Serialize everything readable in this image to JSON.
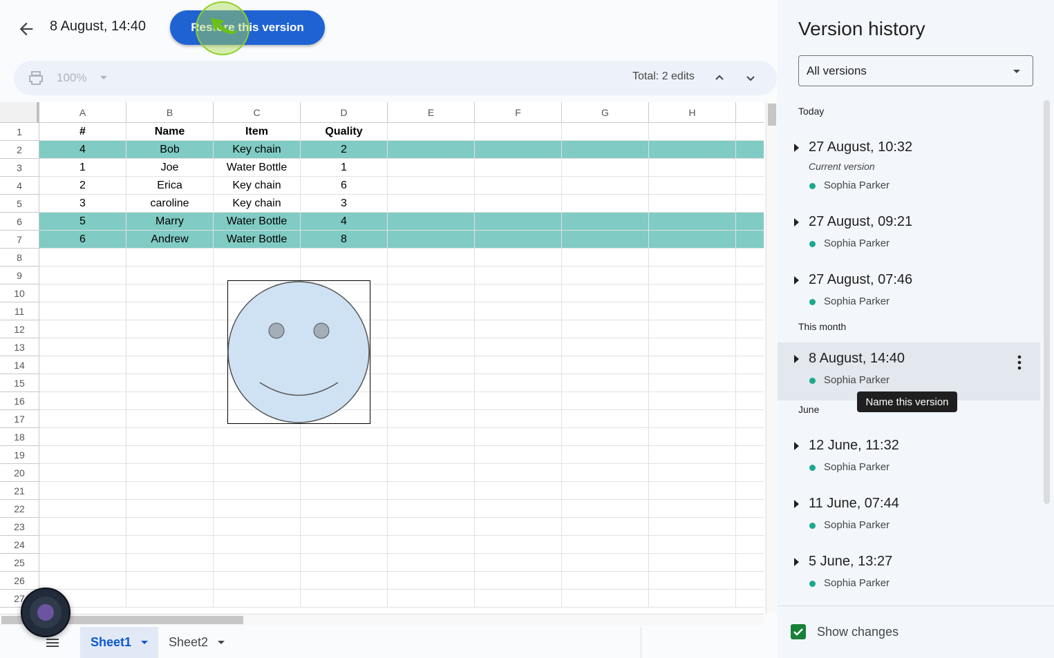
{
  "header": {
    "title": "8 August, 14:40",
    "restore_label": "Restore this version"
  },
  "toolbar": {
    "zoom": "100%",
    "total_edits": "Total: 2 edits"
  },
  "sheet": {
    "columns": [
      "A",
      "B",
      "C",
      "D",
      "E",
      "F",
      "G",
      "H",
      ""
    ],
    "row_count": 27,
    "rows": [
      [
        "#",
        "Name",
        "Item",
        "Quality"
      ],
      [
        "4",
        "Bob",
        "Key chain",
        "2"
      ],
      [
        "1",
        "Joe",
        "Water Bottle",
        "1"
      ],
      [
        "2",
        "Erica",
        "Key chain",
        "6"
      ],
      [
        "3",
        "caroline",
        "Key chain",
        "3"
      ],
      [
        "5",
        "Marry",
        "Water Bottle",
        "4"
      ],
      [
        "6",
        "Andrew",
        "Water Bottle",
        "8"
      ]
    ],
    "header_row_bold": true,
    "highlighted_rows": [
      2,
      6,
      7
    ],
    "highlight_color": "#80cbc4",
    "drawing": "smiley-face"
  },
  "tabs": [
    {
      "label": "Sheet1",
      "active": true
    },
    {
      "label": "Sheet2",
      "active": false
    }
  ],
  "panel": {
    "title": "Version history",
    "filter": "All versions",
    "sections": [
      {
        "label": "Today",
        "versions": [
          {
            "date": "27 August, 10:32",
            "note": "Current version",
            "user": "Sophia Parker"
          },
          {
            "date": "27 August, 09:21",
            "user": "Sophia Parker"
          },
          {
            "date": "27 August, 07:46",
            "user": "Sophia Parker"
          }
        ]
      },
      {
        "label": "This month",
        "versions": [
          {
            "date": "8 August, 14:40",
            "user": "Sophia Parker",
            "selected": true
          }
        ]
      },
      {
        "label": "June",
        "versions": [
          {
            "date": "12 June, 11:32",
            "user": "Sophia Parker"
          },
          {
            "date": "11 June, 07:44",
            "user": "Sophia Parker"
          },
          {
            "date": "5 June, 13:27",
            "user": "Sophia Parker"
          }
        ]
      }
    ],
    "tooltip": "Name this version",
    "show_changes": "Show changes",
    "show_changes_checked": true
  },
  "colors": {
    "accent": "#1f63d3",
    "user_dot": "#1aa88f",
    "checkbox": "#188038"
  }
}
